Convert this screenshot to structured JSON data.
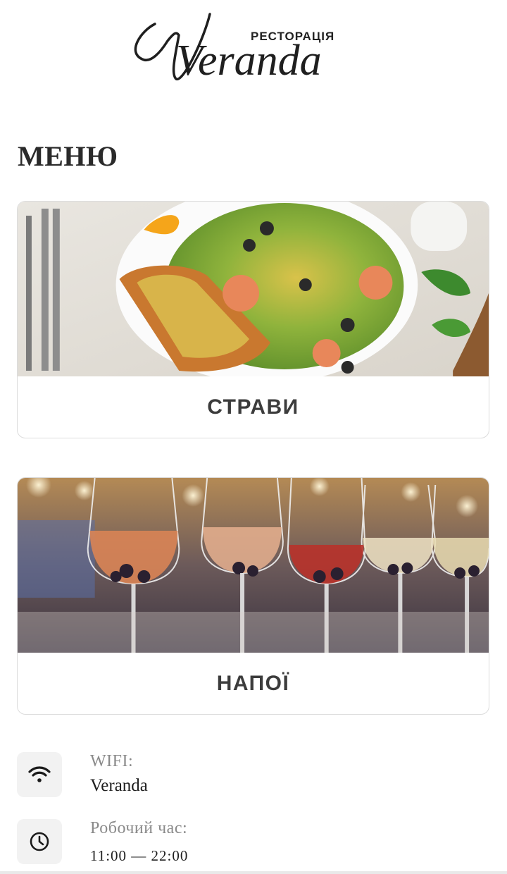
{
  "header": {
    "logo_script": "Veranda",
    "logo_subtitle": "РЕСТОРАЦІЯ"
  },
  "menu": {
    "title": "МЕНЮ",
    "cards": [
      {
        "label": "СТРАВИ",
        "image": "caesar-salad-shrimp-photo"
      },
      {
        "label": "НАПОЇ",
        "image": "wine-glasses-photo"
      }
    ]
  },
  "info": {
    "wifi": {
      "label": "WIFI:",
      "value": "Veranda",
      "icon": "wifi-icon"
    },
    "hours": {
      "label": "Робочий час:",
      "value": "11:00 — 22:00",
      "icon": "clock-icon"
    }
  },
  "colors": {
    "text": "#222222",
    "muted": "#8a8a8a",
    "border": "#dcdcdc",
    "icon_bg": "#f2f2f2"
  }
}
